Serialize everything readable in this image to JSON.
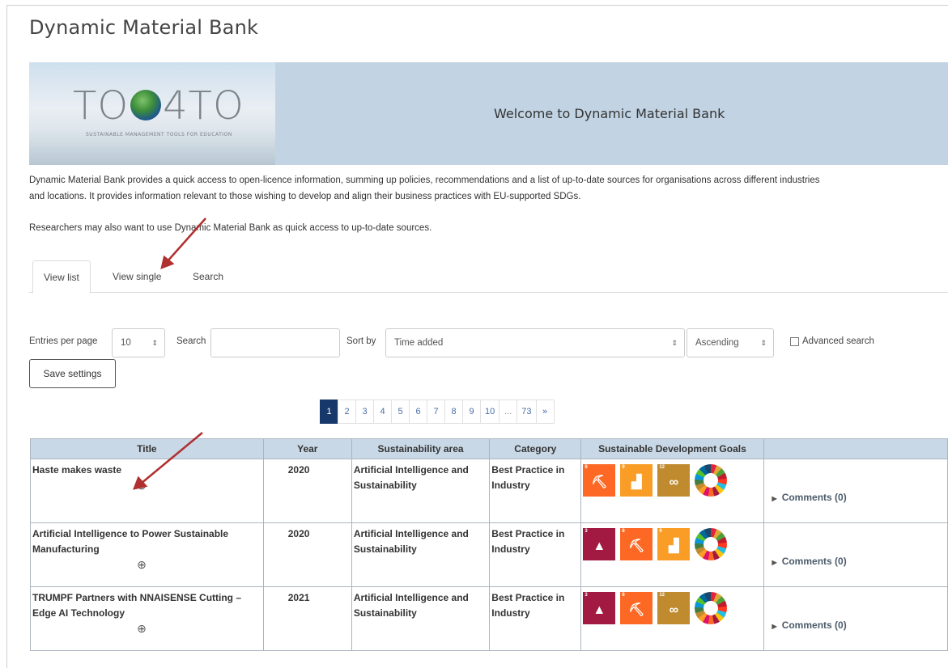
{
  "page": {
    "title": "Dynamic Material Bank"
  },
  "banner": {
    "logo_text_left": "TO",
    "logo_text_right": "4TO",
    "logo_subtitle": "SUSTAINABLE MANAGEMENT TOOLS FOR EDUCATION",
    "welcome": "Welcome to Dynamic Material Bank"
  },
  "intro": {
    "line1": "Dynamic Material Bank provides a quick access to open-licence information, summing up policies, recommendations and a list of up-to-date sources for organisations across different industries",
    "line2": "and locations. It provides information relevant to those wishing to develop and align their business practices with EU-supported SDGs.",
    "line3": "Researchers may also want to use Dynamic Material Bank as quick access to up-to-date sources."
  },
  "tabs": [
    {
      "label": "View list",
      "active": true
    },
    {
      "label": "View single",
      "active": false
    },
    {
      "label": "Search",
      "active": false
    }
  ],
  "controls": {
    "entries_label": "Entries per page",
    "entries_value": "10",
    "search_label": "Search",
    "search_value": "",
    "sortby_label": "Sort by",
    "sortby_value": "Time added",
    "order_value": "Ascending",
    "advanced_label": "Advanced search",
    "save_label": "Save settings"
  },
  "pager": {
    "pages": [
      "1",
      "2",
      "3",
      "4",
      "5",
      "6",
      "7",
      "8",
      "9",
      "10",
      "...",
      "73",
      "»"
    ],
    "current": "1"
  },
  "table": {
    "headers": [
      "Title",
      "Year",
      "Sustainability area",
      "Category",
      "Sustainable Development Goals",
      ""
    ],
    "rows": [
      {
        "title": "Haste makes waste",
        "year": "2020",
        "area": "Artificial Intelligence and Sustainability",
        "category": "Best Practice in Industry",
        "sdgs": [
          "8",
          "9",
          "12"
        ],
        "comments": "Comments (0)"
      },
      {
        "title": "Artificial Intelligence to Power Sustainable Manufacturing",
        "year": "2020",
        "area": "Artificial Intelligence and Sustainability",
        "category": "Best Practice in Industry",
        "sdgs": [
          "3",
          "8",
          "9"
        ],
        "comments": "Comments (0)"
      },
      {
        "title": "TRUMPF Partners with NNAISENSE Cutting – Edge AI Technology",
        "year": "2021",
        "area": "Artificial Intelligence and Sustainability",
        "category": "Best Practice in Industry",
        "sdgs": [
          "3",
          "8",
          "12"
        ],
        "comments": "Comments (0)"
      }
    ]
  },
  "colors": {
    "banner_bg": "#c2d4e4",
    "table_header_bg": "#c9d8e6",
    "pager_active": "#17386b",
    "annotation_arrow": "#b03030",
    "sdg3": "#a21942",
    "sdg8": "#fd6925",
    "sdg9": "#f99d26",
    "sdg12": "#bf8b2e"
  },
  "icons": {
    "zoom": "magnifier-plus-icon",
    "comments_toggle": "triangle-right-icon",
    "sdg_wheel": "sdg-wheel-icon"
  }
}
